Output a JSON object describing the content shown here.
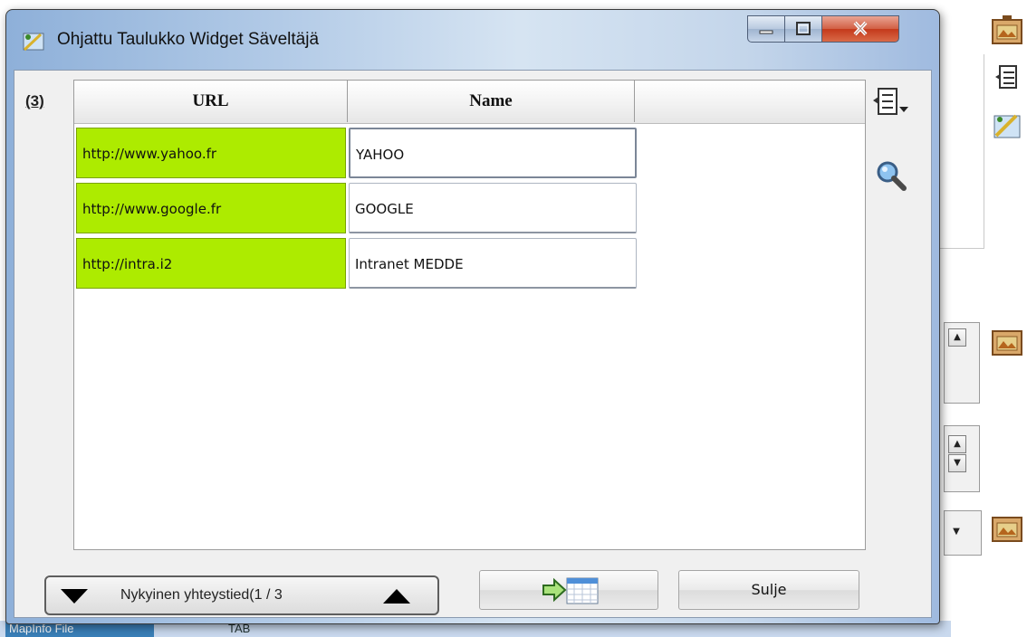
{
  "window": {
    "title": "Ohjattu Taulukko Widget Säveltäjä",
    "minimize_icon": "minimize-icon",
    "maximize_icon": "maximize-icon",
    "close_icon": "close-icon"
  },
  "counter": "(3)",
  "table": {
    "columns": [
      "URL",
      "Name"
    ],
    "rows": [
      {
        "url": "http://www.yahoo.fr",
        "name": "YAHOO"
      },
      {
        "url": "http://www.google.fr",
        "name": "GOOGLE"
      },
      {
        "url": "http://intra.i2",
        "name": "Intranet MEDDE"
      }
    ]
  },
  "tools": {
    "columns_menu_icon": "columns-menu-icon",
    "search_icon": "magnifier-icon"
  },
  "navigator": {
    "text": "Nykyinen yhteystied(1 / 3",
    "prev_icon": "triangle-down-icon",
    "next_icon": "triangle-up-icon"
  },
  "buttons": {
    "calendar_icon": "arrow-calendar-icon",
    "close_label": "Sulje"
  },
  "background": {
    "taskbar_items": [
      "MapInfo File",
      "TAB"
    ]
  },
  "colors": {
    "url_cell_bg": "#adeb00",
    "close_button": "#c4391b",
    "title_bar": "#b3cbe7"
  }
}
